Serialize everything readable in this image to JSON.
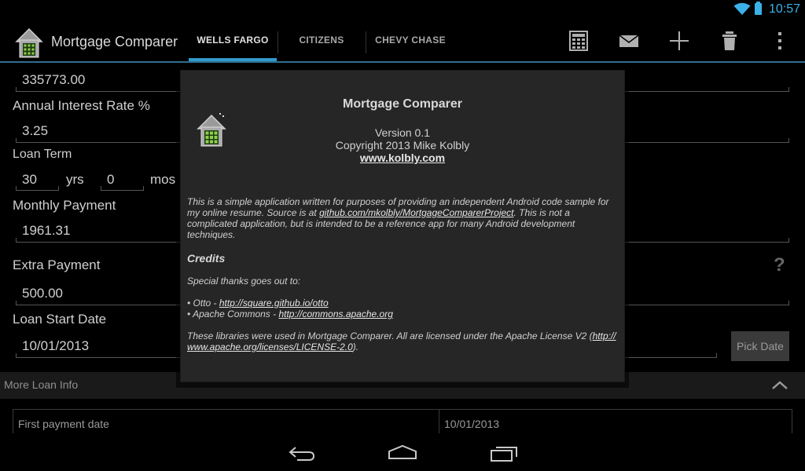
{
  "status_bar": {
    "time": "10:57",
    "colors": {
      "accent": "#3cb0e8"
    }
  },
  "action_bar": {
    "app_title": "Mortgage Comparer",
    "tabs": [
      {
        "label": "WELLS FARGO",
        "active": true
      },
      {
        "label": "CITIZENS",
        "active": false
      },
      {
        "label": "CHEVY CHASE",
        "active": false
      }
    ],
    "actions": [
      "calculator-icon",
      "email-icon",
      "add-icon",
      "trash-icon",
      "overflow-menu-icon"
    ]
  },
  "form": {
    "loan_amount": "335773.00",
    "interest_label": "Annual Interest Rate %",
    "interest_value": "3.25",
    "term_label": "Loan Term",
    "term_years": "30",
    "term_years_unit": "yrs",
    "term_months": "0",
    "term_months_unit": "mos",
    "monthly_label": "Monthly Payment",
    "monthly_value": "1961.31",
    "extra_label": "Extra Payment",
    "extra_value": "500.00",
    "help": "?",
    "start_label": "Loan Start Date",
    "start_value": "10/01/2013",
    "pick_date": "Pick Date"
  },
  "more_info": {
    "label": "More Loan Info",
    "rows": [
      {
        "name": "First payment date",
        "value": "10/01/2013"
      }
    ]
  },
  "dialog": {
    "title": "Mortgage Comparer",
    "version": "Version 0.1",
    "copyright": "Copyright 2013 Mike Kolbly",
    "website": "www.kolbly.com",
    "para1_a": "This is a simple application written for purposes of providing an independent Android code sample for",
    "para1_b": "my online resume. Source is at ",
    "para1_link": "github.com/mkolbly/MortgageComparerProject",
    "para1_c": ". This is not a",
    "para1_d": "complicated application, but is intended to be a reference app for many Android development",
    "para1_e": "techniques.",
    "credits_heading": "Credits",
    "thanks": "Special thanks goes out to:",
    "lib1_prefix": "• Otto - ",
    "lib1_link": "http://square.github.io/otto",
    "lib2_prefix": "• Apache Commons - ",
    "lib2_link": "http://commons.apache.org",
    "license_a": "These libraries were used in Mortgage Comparer. All are licensed under the Apache License V2 (",
    "license_link1": "http://",
    "license_link2": "www.apache.org/licenses/LICENSE-2.0",
    "license_b": ")."
  }
}
